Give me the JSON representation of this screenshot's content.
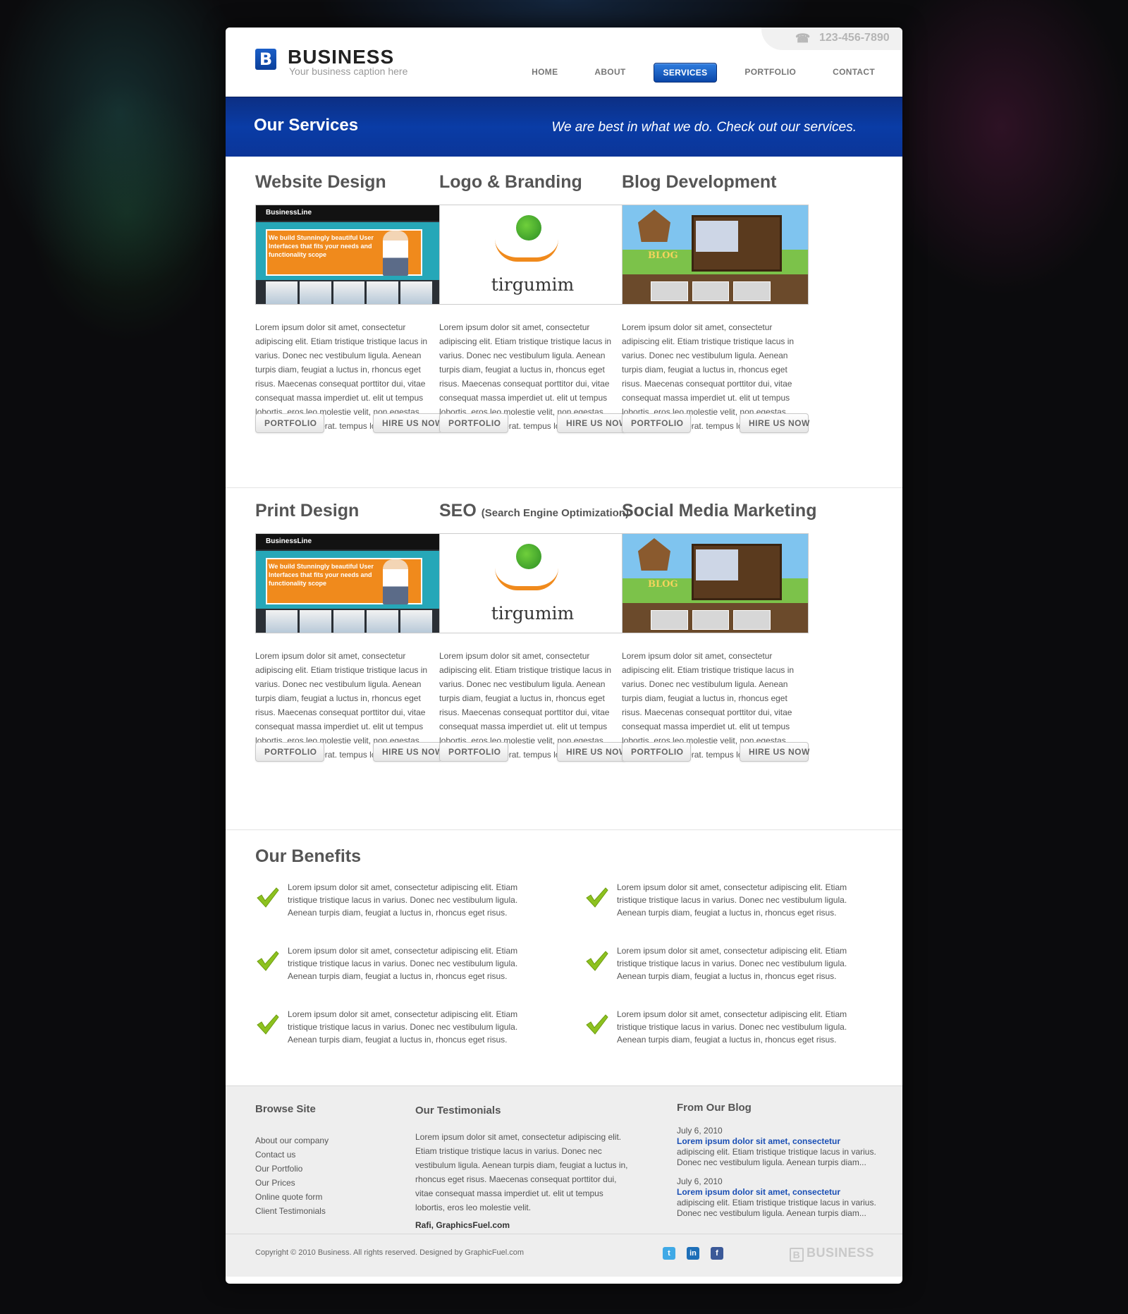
{
  "header": {
    "logo_mark": "B",
    "logo_name": "BUSINESS",
    "logo_caption": "Your business caption here",
    "phone": "123-456-7890",
    "nav": [
      "HOME",
      "ABOUT",
      "SERVICES",
      "PORTFOLIO",
      "CONTACT"
    ],
    "active_nav": "SERVICES"
  },
  "banner": {
    "title": "Our Services",
    "tagline": "We are best in what we do. Check out our services."
  },
  "services": [
    {
      "title": "Website Design",
      "subtitle": "",
      "thumb": "website-screenshot",
      "thumb_brand": "BusinessLine",
      "thumb_headline": "We build Stunningly beautiful User Interfaces that fits your needs and functionality scope"
    },
    {
      "title": "Logo & Branding",
      "subtitle": "",
      "thumb": "logo-tirgumim",
      "thumb_word": "tirgumim"
    },
    {
      "title": "Blog Development",
      "subtitle": "",
      "thumb": "blog-screenshot",
      "thumb_title": "BLOG"
    },
    {
      "title": "Print Design",
      "subtitle": "",
      "thumb": "website-screenshot",
      "thumb_brand": "BusinessLine",
      "thumb_headline": "We build Stunningly beautiful User Interfaces that fits your needs and functionality scope"
    },
    {
      "title": "SEO",
      "subtitle": "(Search Engine Optimization)",
      "thumb": "logo-tirgumim",
      "thumb_word": "tirgumim"
    },
    {
      "title": "Social Media Marketing",
      "subtitle": "",
      "thumb": "blog-screenshot",
      "thumb_title": "BLOG"
    }
  ],
  "service_text": "Lorem ipsum dolor sit amet, consectetur adipiscing elit. Etiam tristique tristique lacus in varius. Donec nec vestibulum ligula. Aenean turpis diam, feugiat a luctus in, rhoncus eget risus. Maecenas consequat porttitor dui, vitae consequat massa imperdiet ut. elit ut tempus lobortis, eros leo molestie velit, non egestas augue nulla eget erat. tempus lobortis.",
  "buttons": {
    "portfolio": "PORTFOLIO",
    "hire": "HIRE US NOW"
  },
  "benefits": {
    "title": "Our Benefits",
    "text": "Lorem ipsum dolor sit amet, consectetur adipiscing elit. Etiam tristique tristique lacus in varius. Donec nec vestibulum ligula. Aenean turpis diam, feugiat a luctus in, rhoncus eget risus.",
    "icon": "checkmark-icon",
    "count": 6
  },
  "footer": {
    "browse_title": "Browse Site",
    "browse_links": [
      "About our company",
      "Contact us",
      "Our Portfolio",
      "Our Prices",
      "Online quote form",
      "Client Testimonials"
    ],
    "testimonials_title": "Our Testimonials",
    "testimonial_text": "Lorem ipsum dolor sit amet, consectetur adipiscing elit. Etiam tristique tristique lacus in varius. Donec nec vestibulum ligula. Aenean turpis diam, feugiat a luctus in, rhoncus eget risus. Maecenas consequat porttitor dui, vitae consequat massa imperdiet ut. elit ut tempus lobortis, eros leo molestie velit.",
    "testimonial_author": "Rafi, GraphicsFuel.com",
    "blog_title": "From Our Blog",
    "blog_posts": [
      {
        "date": "July 6, 2010",
        "title": "Lorem ipsum dolor sit amet, consectetur",
        "excerpt": "adipiscing elit. Etiam tristique tristique lacus in varius. Donec nec vestibulum ligula. Aenean turpis diam..."
      },
      {
        "date": "July 6, 2010",
        "title": "Lorem ipsum dolor sit amet, consectetur",
        "excerpt": "adipiscing elit. Etiam tristique tristique lacus in varius. Donec nec vestibulum ligula. Aenean turpis diam..."
      }
    ],
    "copyright": "Copyright © 2010 Business. All rights reserved. Designed by GraphicFuel.com",
    "social": [
      {
        "name": "twitter-icon",
        "glyph": "t",
        "color": "#3fa9e6"
      },
      {
        "name": "linkedin-icon",
        "glyph": "in",
        "color": "#1d6fb8"
      },
      {
        "name": "facebook-icon",
        "glyph": "f",
        "color": "#3b5998"
      }
    ],
    "logo_mark": "B",
    "logo_name": "BUSINESS"
  },
  "colors": {
    "accent": "#0b3fa2",
    "link": "#1a4fb5",
    "check": "#8dc21f"
  }
}
